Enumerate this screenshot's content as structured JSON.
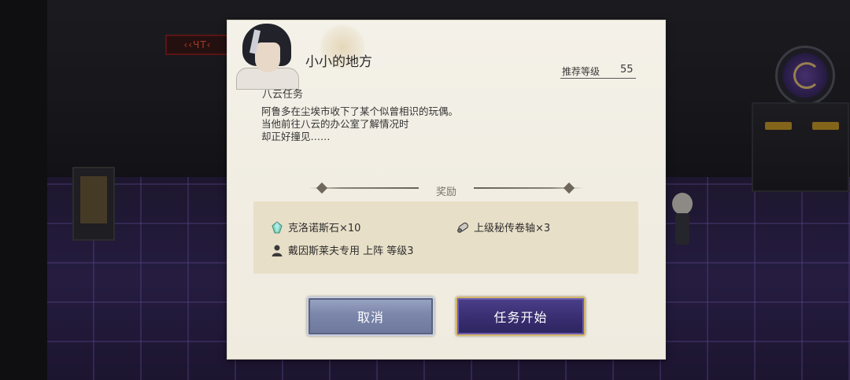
{
  "scene": {
    "sign_text": "‹‹ЧТ‹"
  },
  "dialog": {
    "title": "小小的地方",
    "recommended_level_label": "推荐等级",
    "recommended_level_value": "55",
    "quest_type": "八云任务",
    "story_lines": [
      "阿鲁多在尘埃市收下了某个似曾相识的玩偶。",
      "当他前往八云的办公室了解情况时",
      "却正好撞见……"
    ],
    "rewards_header": "奖励",
    "rewards": [
      {
        "icon": "crystal-icon",
        "label": "克洛诺斯石×10"
      },
      {
        "icon": "scroll-icon",
        "label": "上级秘传卷轴×3"
      },
      {
        "icon": "character-icon",
        "label": "戴因斯莱夫专用 上阵 等级3"
      }
    ],
    "cancel_label": "取消",
    "start_label": "任务开始"
  },
  "colors": {
    "dialog_bg": "#f2eee4",
    "reward_box_bg": "#e8dfc8",
    "cancel_button": "#7c86aa",
    "start_button": "#3a2f72",
    "start_border": "#d4b76a"
  }
}
